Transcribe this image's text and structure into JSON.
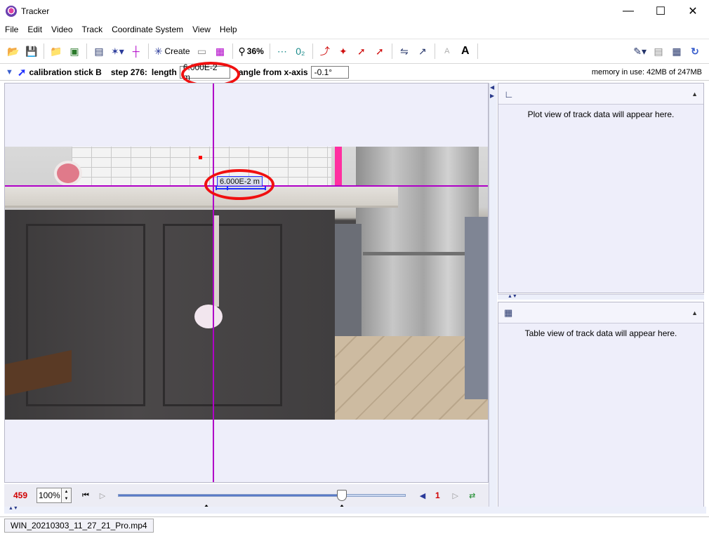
{
  "window": {
    "title": "Tracker",
    "minimize": "—",
    "maximize": "☐",
    "close": "✕"
  },
  "menu": [
    "File",
    "Edit",
    "Video",
    "Track",
    "Coordinate System",
    "View",
    "Help"
  ],
  "toolbar": {
    "create_label": "Create",
    "zoom_label": "36%",
    "font_smaller": "A",
    "font_larger": "A"
  },
  "trackbar": {
    "track_name": "calibration stick B",
    "step_label": "step 276:",
    "length_label": "length",
    "length_value": "6.000E-2 m",
    "angle_label": "angle from x-axis",
    "angle_value": "-0.1°",
    "memory": "memory in use: 42MB of 247MB"
  },
  "video": {
    "calibration_label": "6.000E-2 m"
  },
  "plot_panel": {
    "message": "Plot view of track data will appear here."
  },
  "table_panel": {
    "message": "Table view of track data will appear here."
  },
  "player": {
    "frame_number": "459",
    "zoom": "100%",
    "step_value": "1",
    "slider_position": 0.78
  },
  "tabs": [
    "WIN_20210303_11_27_21_Pro.mp4"
  ],
  "colors": {
    "axis": "#b000c8",
    "calibration": "#2030ff",
    "highlight": "#f01010",
    "frame_number": "#d00000"
  }
}
